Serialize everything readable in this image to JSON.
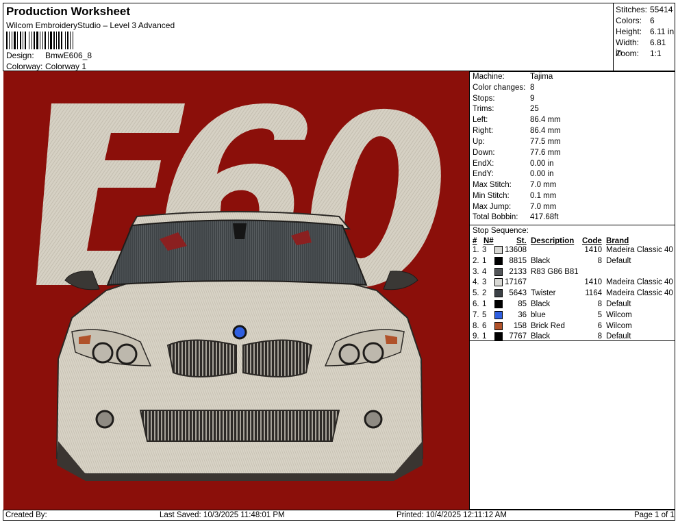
{
  "header": {
    "title": "Production Worksheet",
    "subtitle": "Wilcom EmbroideryStudio – Level 3 Advanced",
    "design_label": "Design:",
    "design_value": "BmwE606_8",
    "colorway_label": "Colorway:",
    "colorway_value": "Colorway 1"
  },
  "stats": {
    "stitches_label": "Stitches:",
    "stitches_value": "55414",
    "colors_label": "Colors:",
    "colors_value": "6",
    "height_label": "Height:",
    "height_value": "6.11 in",
    "width_label": "Width:",
    "width_value": "6.81 in",
    "zoom_label": "Zoom:",
    "zoom_value": "1:1"
  },
  "machine_info": [
    {
      "label": "Machine:",
      "value": "Tajima"
    },
    {
      "label": "Color changes:",
      "value": "8"
    },
    {
      "label": "Stops:",
      "value": "9"
    },
    {
      "label": "Trims:",
      "value": "25"
    },
    {
      "label": "Left:",
      "value": "86.4 mm"
    },
    {
      "label": "Right:",
      "value": "86.4 mm"
    },
    {
      "label": "Up:",
      "value": "77.5 mm"
    },
    {
      "label": "Down:",
      "value": "77.6 mm"
    },
    {
      "label": "EndX:",
      "value": "0.00 in"
    },
    {
      "label": "EndY:",
      "value": "0.00 in"
    },
    {
      "label": "Max Stitch:",
      "value": "7.0 mm"
    },
    {
      "label": "Min Stitch:",
      "value": "0.1 mm"
    },
    {
      "label": "Max Jump:",
      "value": "7.0 mm"
    },
    {
      "label": "Total Bobbin:",
      "value": "417.68ft"
    }
  ],
  "stop_sequence": {
    "title": "Stop Sequence:",
    "columns": {
      "num": "#",
      "needle": "N#",
      "stitches": "St.",
      "description": "Description",
      "code": "Code",
      "brand": "Brand"
    },
    "rows": [
      {
        "num": "1.",
        "needle": "3",
        "color": "#d8d8d4",
        "stitches": "13608",
        "description": "",
        "code": "1410",
        "brand": "Madeira Classic 40"
      },
      {
        "num": "2.",
        "needle": "1",
        "color": "#000000",
        "stitches": "8815",
        "description": "Black",
        "code": "8",
        "brand": "Default"
      },
      {
        "num": "3.",
        "needle": "4",
        "color": "#535659",
        "stitches": "2133",
        "description": "R83 G86 B81",
        "code": "",
        "brand": ""
      },
      {
        "num": "4.",
        "needle": "3",
        "color": "#d8d8d4",
        "stitches": "17167",
        "description": "",
        "code": "1410",
        "brand": "Madeira Classic 40"
      },
      {
        "num": "5.",
        "needle": "2",
        "color": "#3b4146",
        "stitches": "5643",
        "description": "Twister",
        "code": "1164",
        "brand": "Madeira Classic 40"
      },
      {
        "num": "6.",
        "needle": "1",
        "color": "#000000",
        "stitches": "85",
        "description": "Black",
        "code": "8",
        "brand": "Default"
      },
      {
        "num": "7.",
        "needle": "5",
        "color": "#2f5fe0",
        "stitches": "36",
        "description": "blue",
        "code": "5",
        "brand": "Wilcom"
      },
      {
        "num": "8.",
        "needle": "6",
        "color": "#b0522a",
        "stitches": "158",
        "description": "Brick Red",
        "code": "6",
        "brand": "Wilcom"
      },
      {
        "num": "9.",
        "needle": "1",
        "color": "#000000",
        "stitches": "7767",
        "description": "Black",
        "code": "8",
        "brand": "Default"
      }
    ]
  },
  "footer": {
    "created": "Created By:",
    "saved": "Last Saved: 10/3/2025 11:48:01 PM",
    "printed": "Printed: 10/4/2025 12:11:12 AM",
    "page": "Page 1 of 1"
  },
  "design_preview": {
    "background_color": "#8b0f0a",
    "text": "E60"
  }
}
